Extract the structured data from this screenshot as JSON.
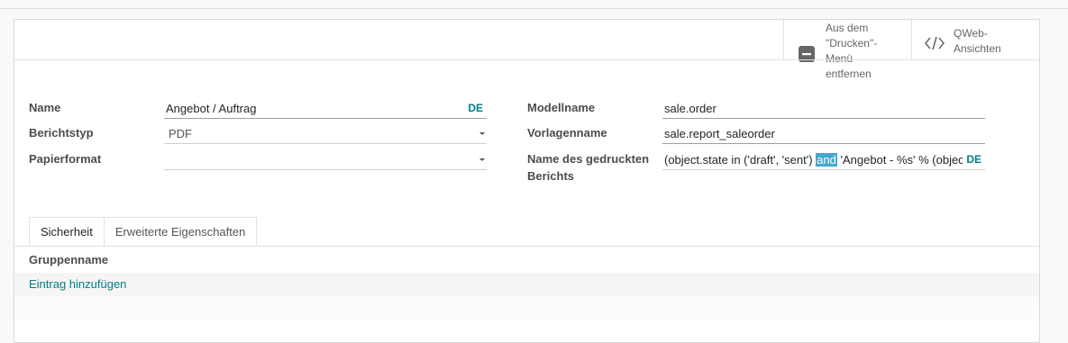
{
  "button_box": {
    "remove_print": "Aus dem \"Drucken\"-Menü entfernen",
    "remove_print_lines": [
      "Aus dem",
      "\"Drucken\"-",
      "Menü",
      "entfernen"
    ],
    "qweb_lines": [
      "QWeb-",
      "Ansichten"
    ]
  },
  "form": {
    "name_label": "Name",
    "name_value": "Angebot / Auftrag",
    "name_lang": "DE",
    "report_type_label": "Berichtstyp",
    "report_type_value": "PDF",
    "paper_format_label": "Papierformat",
    "paper_format_value": "",
    "model_label": "Modellname",
    "model_value": "sale.order",
    "template_label": "Vorlagenname",
    "template_value": "sale.report_saleorder",
    "printed_name_label_lines": [
      "Name des gedruckten",
      "Berichts"
    ],
    "printed_name_before": "(object.state in ('draft', 'sent') ",
    "printed_name_highlight": "and",
    "printed_name_after": " 'Angebot - %s' % (object.",
    "printed_name_lang": "DE"
  },
  "tabs": [
    {
      "label": "Sicherheit",
      "active": true
    },
    {
      "label": "Erweiterte Eigenschaften",
      "active": false
    }
  ],
  "groups_table": {
    "column_header": "Gruppenname",
    "add_line": "Eintrag hinzufügen"
  },
  "colors": {
    "accent": "#017e84",
    "highlight": "#45a7cf"
  },
  "icons": [
    "minus-square-icon",
    "code-icon",
    "dropdown-caret-icon"
  ]
}
